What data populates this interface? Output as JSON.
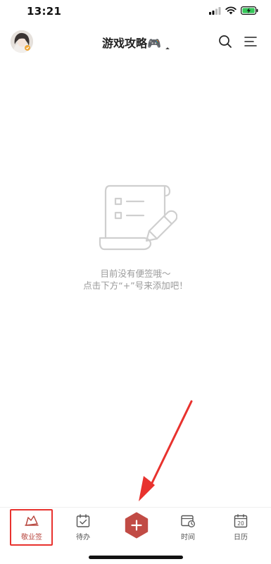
{
  "status_bar": {
    "time": "13:21"
  },
  "header": {
    "title": "游戏攻略🎮"
  },
  "empty_state": {
    "line1": "目前没有便签哦～",
    "line2": "点击下方“+”号来添加吧！"
  },
  "tab_bar": {
    "tabs": [
      {
        "label": "敬业签",
        "icon": "sticky-note-icon",
        "active": true
      },
      {
        "label": "待办",
        "icon": "todo-calendar-check-icon",
        "active": false
      },
      {
        "label": "时间",
        "icon": "time-calendar-icon",
        "active": false
      },
      {
        "label": "日历",
        "icon": "calendar-icon",
        "active": false
      }
    ],
    "calendar_day": "20"
  },
  "colors": {
    "accent": "#b84840",
    "highlight_box": "#e8322e",
    "annotation_arrow": "#e8322e",
    "battery": "#35c759"
  }
}
